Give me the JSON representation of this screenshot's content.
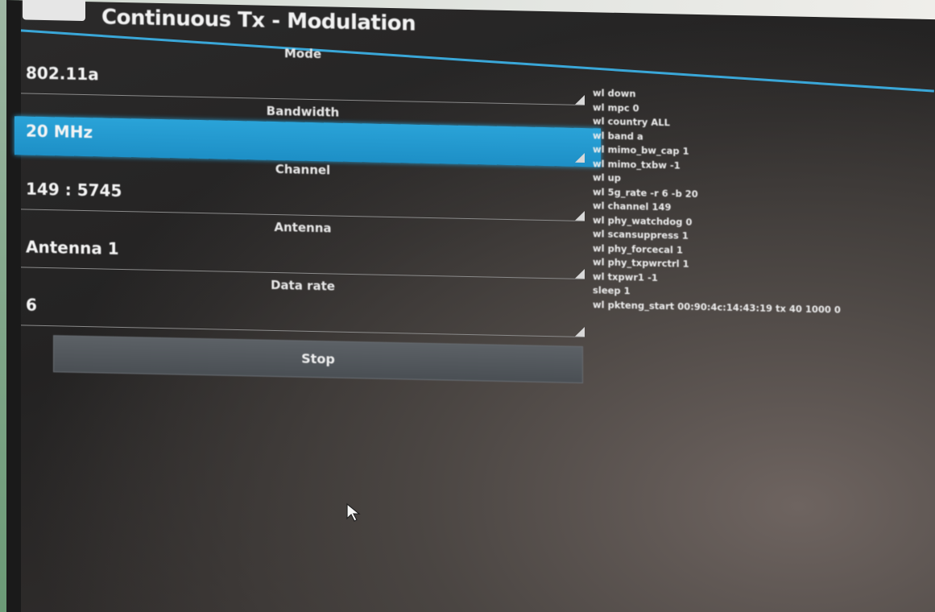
{
  "app": {
    "title": "Continuous Tx - Modulation"
  },
  "fields": [
    {
      "label": "Mode",
      "value": "802.11a",
      "selected": false
    },
    {
      "label": "Bandwidth",
      "value": "20 MHz",
      "selected": true
    },
    {
      "label": "Channel",
      "value": "149 : 5745",
      "selected": false
    },
    {
      "label": "Antenna",
      "value": "Antenna 1",
      "selected": false
    },
    {
      "label": "Data rate",
      "value": "6",
      "selected": false
    }
  ],
  "actions": {
    "stop_label": "Stop"
  },
  "log": [
    "wl down",
    "wl mpc 0",
    "wl country ALL",
    "wl band a",
    "wl mimo_bw_cap 1",
    "wl mimo_txbw -1",
    "wl up",
    "wl 5g_rate -r 6 -b 20",
    "wl channel 149",
    "wl phy_watchdog 0",
    "wl scansuppress 1",
    "wl phy_forcecal 1",
    "wl phy_txpwrctrl 1",
    "wl txpwr1 -1",
    "sleep 1",
    "wl pkteng_start 00:90:4c:14:43:19 tx 40 1000 0"
  ],
  "colors": {
    "accent": "#2aa3d8",
    "background": "#262525",
    "text": "#f2f2f2"
  },
  "icons": {
    "pointer": "mouse-pointer-icon",
    "dropdown": "dropdown-arrow-icon"
  }
}
